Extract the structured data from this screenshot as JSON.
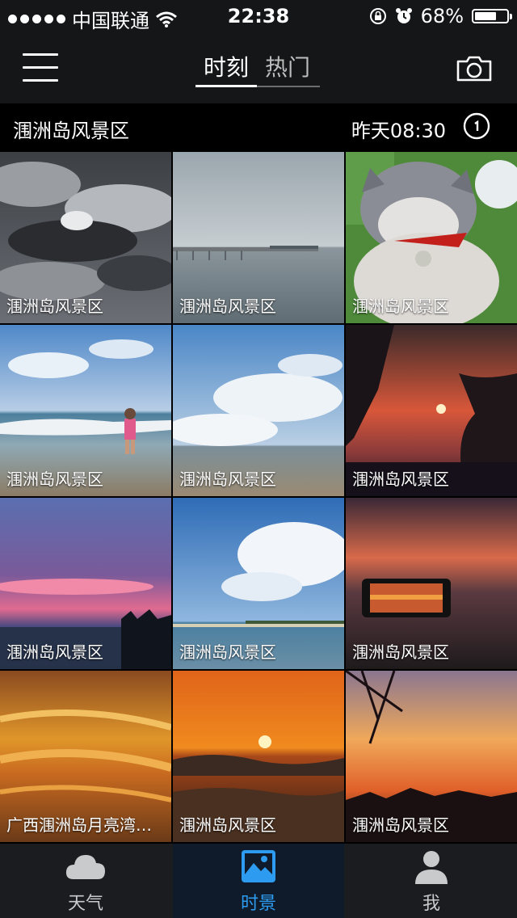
{
  "status_bar": {
    "carrier": "中国联通",
    "time": "22:38",
    "battery_percent": "68%",
    "battery_level": 0.68
  },
  "header": {
    "tabs": [
      {
        "label": "时刻",
        "active": true
      },
      {
        "label": "热门",
        "active": false
      }
    ],
    "menu_icon": "hamburger-icon",
    "camera_icon": "camera-icon"
  },
  "location_bar": {
    "location": "涠洲岛风景区",
    "time": "昨天08:30",
    "clock_icon": "clock-icon"
  },
  "photos": [
    {
      "caption": "涠洲岛风景区",
      "scene": "cloudy-sky"
    },
    {
      "caption": "涠洲岛风景区",
      "scene": "bridge-sea"
    },
    {
      "caption": "涠洲岛风景区",
      "scene": "cat"
    },
    {
      "caption": "涠洲岛风景区",
      "scene": "beach-child"
    },
    {
      "caption": "涠洲岛风景区",
      "scene": "beach-clouds"
    },
    {
      "caption": "涠洲岛风景区",
      "scene": "sunset-trees"
    },
    {
      "caption": "涠洲岛风景区",
      "scene": "purple-sunset"
    },
    {
      "caption": "涠洲岛风景区",
      "scene": "blue-sky-clouds"
    },
    {
      "caption": "涠洲岛风景区",
      "scene": "phone-sunset"
    },
    {
      "caption": "广西涠洲岛月亮湾…",
      "scene": "golden-sky"
    },
    {
      "caption": "涠洲岛风景区",
      "scene": "orange-sunset-waves"
    },
    {
      "caption": "涠洲岛风景区",
      "scene": "dusk-branches"
    }
  ],
  "tab_bar": {
    "items": [
      {
        "label": "天气",
        "icon": "cloud-icon",
        "active": false
      },
      {
        "label": "时景",
        "icon": "picture-icon",
        "active": true
      },
      {
        "label": "我",
        "icon": "user-icon",
        "active": false
      }
    ],
    "active_color": "#2d9bf0"
  }
}
